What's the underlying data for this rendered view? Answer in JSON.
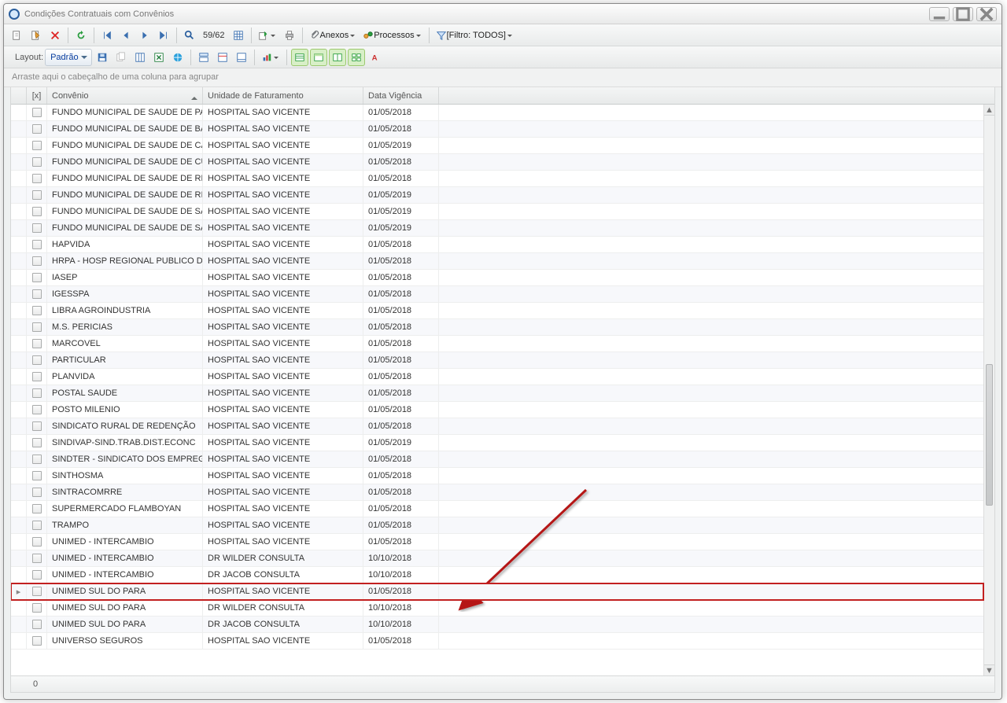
{
  "window": {
    "title": "Condições Contratuais com Convênios"
  },
  "toolbar": {
    "record_counter": "59/62",
    "anexos_label": "Anexos",
    "processos_label": "Processos",
    "filter_label": "[Filtro: TODOS]"
  },
  "layoutbar": {
    "layout_label": "Layout:",
    "layout_value": "Padrão"
  },
  "grouping": {
    "placeholder": "Arraste aqui o cabeçalho de uma coluna para agrupar"
  },
  "columns": {
    "check": "[x]",
    "convenio": "Convênio",
    "unidade": "Unidade de Faturamento",
    "data": "Data Vigência"
  },
  "status": {
    "text": "0"
  },
  "highlight_index": 28,
  "rows": [
    {
      "convenio": "FUNDO MUNICIPAL DE SAUDE DE  PAU...",
      "unidade": "HOSPITAL SAO VICENTE",
      "data": "01/05/2018"
    },
    {
      "convenio": "FUNDO MUNICIPAL DE SAUDE DE BAN...",
      "unidade": "HOSPITAL SAO VICENTE",
      "data": "01/05/2018"
    },
    {
      "convenio": "FUNDO MUNICIPAL DE SAUDE DE CAN...",
      "unidade": "HOSPITAL SAO VICENTE",
      "data": "01/05/2019"
    },
    {
      "convenio": "FUNDO MUNICIPAL DE SAUDE DE CUM...",
      "unidade": "HOSPITAL SAO VICENTE",
      "data": "01/05/2018"
    },
    {
      "convenio": "FUNDO MUNICIPAL DE SAUDE DE RED...",
      "unidade": "HOSPITAL SAO VICENTE",
      "data": "01/05/2018"
    },
    {
      "convenio": "FUNDO MUNICIPAL DE SAUDE DE RIO ...",
      "unidade": "HOSPITAL SAO VICENTE",
      "data": "01/05/2019"
    },
    {
      "convenio": "FUNDO MUNICIPAL DE SAUDE DE SAN...",
      "unidade": "HOSPITAL SAO VICENTE",
      "data": "01/05/2019"
    },
    {
      "convenio": "FUNDO MUNICIPAL DE SAUDE DE SAN...",
      "unidade": "HOSPITAL SAO VICENTE",
      "data": "01/05/2019"
    },
    {
      "convenio": "HAPVIDA",
      "unidade": "HOSPITAL SAO VICENTE",
      "data": "01/05/2018"
    },
    {
      "convenio": "HRPA - HOSP REGIONAL PUBLICO DO ...",
      "unidade": "HOSPITAL SAO VICENTE",
      "data": "01/05/2018"
    },
    {
      "convenio": "IASEP",
      "unidade": "HOSPITAL SAO VICENTE",
      "data": "01/05/2018"
    },
    {
      "convenio": "IGESSPA",
      "unidade": "HOSPITAL SAO VICENTE",
      "data": "01/05/2018"
    },
    {
      "convenio": "LIBRA AGROINDUSTRIA",
      "unidade": "HOSPITAL SAO VICENTE",
      "data": "01/05/2018"
    },
    {
      "convenio": "M.S. PERICIAS",
      "unidade": "HOSPITAL SAO VICENTE",
      "data": "01/05/2018"
    },
    {
      "convenio": "MARCOVEL",
      "unidade": "HOSPITAL SAO VICENTE",
      "data": "01/05/2018"
    },
    {
      "convenio": "PARTICULAR",
      "unidade": "HOSPITAL SAO VICENTE",
      "data": "01/05/2018"
    },
    {
      "convenio": "PLANVIDA",
      "unidade": "HOSPITAL SAO VICENTE",
      "data": "01/05/2018"
    },
    {
      "convenio": "POSTAL SAUDE",
      "unidade": "HOSPITAL SAO VICENTE",
      "data": "01/05/2018"
    },
    {
      "convenio": "POSTO MILENIO",
      "unidade": "HOSPITAL SAO VICENTE",
      "data": "01/05/2018"
    },
    {
      "convenio": "SINDICATO RURAL DE REDENÇÃO",
      "unidade": "HOSPITAL SAO VICENTE",
      "data": "01/05/2018"
    },
    {
      "convenio": "SINDIVAP-SIND.TRAB.DIST.ECONC",
      "unidade": "HOSPITAL SAO VICENTE",
      "data": "01/05/2019"
    },
    {
      "convenio": "SINDTER - SINDICATO DOS EMPREGA...",
      "unidade": "HOSPITAL SAO VICENTE",
      "data": "01/05/2018"
    },
    {
      "convenio": "SINTHOSMA",
      "unidade": "HOSPITAL SAO VICENTE",
      "data": "01/05/2018"
    },
    {
      "convenio": "SINTRACOMRRE",
      "unidade": "HOSPITAL SAO VICENTE",
      "data": "01/05/2018"
    },
    {
      "convenio": "SUPERMERCADO FLAMBOYAN",
      "unidade": "HOSPITAL SAO VICENTE",
      "data": "01/05/2018"
    },
    {
      "convenio": "TRAMPO",
      "unidade": "HOSPITAL SAO VICENTE",
      "data": "01/05/2018"
    },
    {
      "convenio": "UNIMED - INTERCAMBIO",
      "unidade": "HOSPITAL SAO VICENTE",
      "data": "01/05/2018"
    },
    {
      "convenio": "UNIMED - INTERCAMBIO",
      "unidade": "DR WILDER CONSULTA",
      "data": "10/10/2018"
    },
    {
      "convenio": "UNIMED - INTERCAMBIO",
      "unidade": "DR JACOB CONSULTA",
      "data": "10/10/2018"
    },
    {
      "convenio": "UNIMED SUL DO PARA",
      "unidade": "HOSPITAL SAO VICENTE",
      "data": "01/05/2018"
    },
    {
      "convenio": "UNIMED SUL DO PARA",
      "unidade": "DR WILDER CONSULTA",
      "data": "10/10/2018"
    },
    {
      "convenio": "UNIMED SUL DO PARA",
      "unidade": "DR JACOB CONSULTA",
      "data": "10/10/2018"
    },
    {
      "convenio": "UNIVERSO SEGUROS",
      "unidade": "HOSPITAL SAO VICENTE",
      "data": "01/05/2018"
    }
  ]
}
